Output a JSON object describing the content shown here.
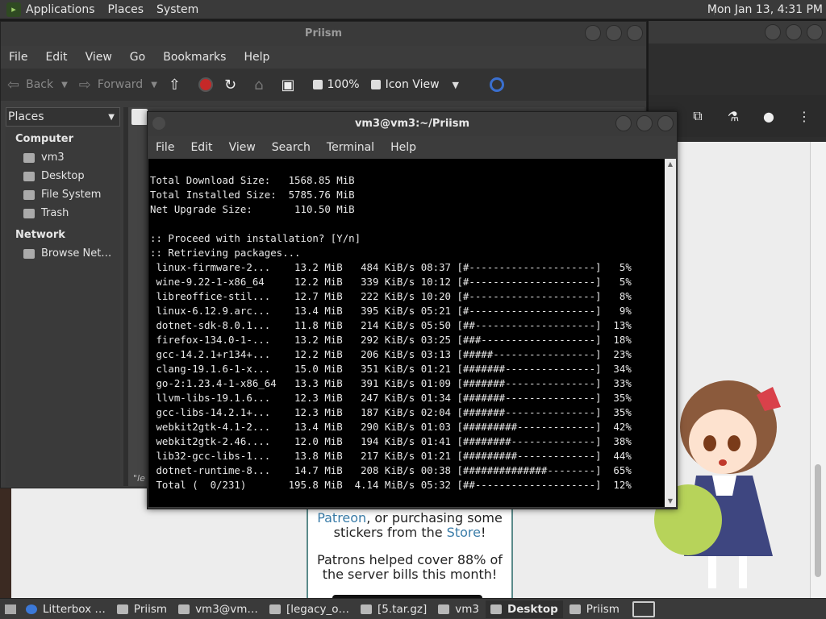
{
  "top_panel": {
    "menus": [
      "Applications",
      "Places",
      "System"
    ],
    "clock": "Mon Jan 13,  4:31 PM"
  },
  "file_manager": {
    "title": "Priism",
    "menus": [
      "File",
      "Edit",
      "View",
      "Go",
      "Bookmarks",
      "Help"
    ],
    "nav": {
      "back": "Back",
      "forward": "Forward",
      "zoom": "100%",
      "view_mode": "Icon View"
    },
    "sidebar": {
      "header": "Places",
      "sections": [
        {
          "title": "Computer",
          "items": [
            "vm3",
            "Desktop",
            "File System",
            "Trash"
          ]
        },
        {
          "title": "Network",
          "items": [
            "Browse Net…"
          ]
        }
      ]
    },
    "status_fragment": "\"le"
  },
  "terminal": {
    "title": "vm3@vm3:~/Priism",
    "menus": [
      "File",
      "Edit",
      "View",
      "Search",
      "Terminal",
      "Help"
    ],
    "lines": [
      "Total Download Size:   1568.85 MiB",
      "Total Installed Size:  5785.76 MiB",
      "Net Upgrade Size:       110.50 MiB",
      "",
      ":: Proceed with installation? [Y/n]",
      ":: Retrieving packages...",
      " linux-firmware-2...    13.2 MiB   484 KiB/s 08:37 [#---------------------]   5%",
      " wine-9.22-1-x86_64     12.2 MiB   339 KiB/s 10:12 [#---------------------]   5%",
      " libreoffice-stil...    12.7 MiB   222 KiB/s 10:20 [#---------------------]   8%",
      " linux-6.12.9.arc...    13.4 MiB   395 KiB/s 05:21 [#---------------------]   9%",
      " dotnet-sdk-8.0.1...    11.8 MiB   214 KiB/s 05:50 [##--------------------]  13%",
      " firefox-134.0-1-...    13.2 MiB   292 KiB/s 03:25 [###-------------------]  18%",
      " gcc-14.2.1+r134+...    12.2 MiB   206 KiB/s 03:13 [#####-----------------]  23%",
      " clang-19.1.6-1-x...    15.0 MiB   351 KiB/s 01:21 [#######---------------]  34%",
      " go-2:1.23.4-1-x86_64   13.3 MiB   391 KiB/s 01:09 [#######---------------]  33%",
      " llvm-libs-19.1.6...    12.3 MiB   247 KiB/s 01:34 [#######---------------]  35%",
      " gcc-libs-14.2.1+...    12.3 MiB   187 KiB/s 02:04 [#######---------------]  35%",
      " webkit2gtk-4.1-2...    13.4 MiB   290 KiB/s 01:03 [#########-------------]  42%",
      " webkit2gtk-2.46....    12.0 MiB   194 KiB/s 01:41 [########--------------]  38%",
      " lib32-gcc-libs-1...    13.8 MiB   217 KiB/s 01:21 [#########-------------]  44%",
      " dotnet-runtime-8...    14.7 MiB   208 KiB/s 00:38 [##############--------]  65%",
      " Total (  0/231)       195.8 MiB  4.14 MiB/s 05:32 [##--------------------]  12%"
    ]
  },
  "web_page": {
    "line1_link": "Patreon",
    "line1_rest": ", or purchasing some",
    "line2_pre": "stickers from the ",
    "line2_link": "Store",
    "line2_post": "!",
    "patrons": "Patrons helped cover 88% of the server bills this month!"
  },
  "taskbar": {
    "tasks": [
      {
        "label": "Litterbox …",
        "active": false
      },
      {
        "label": "Priism",
        "active": false
      },
      {
        "label": "vm3@vm…",
        "active": false
      },
      {
        "label": "[legacy_o…",
        "active": false
      },
      {
        "label": "[5.tar.gz]",
        "active": false
      },
      {
        "label": "vm3",
        "active": false
      },
      {
        "label": "Desktop",
        "active": true
      },
      {
        "label": "Priism",
        "active": false
      }
    ]
  }
}
